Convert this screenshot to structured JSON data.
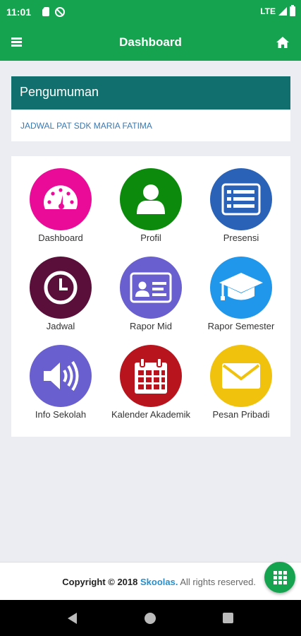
{
  "status_bar": {
    "time": "11:01",
    "network": "LTE"
  },
  "header": {
    "title": "Dashboard",
    "menu_icon": "menu-icon",
    "home_icon": "home-icon"
  },
  "announcement": {
    "title": "Pengumuman",
    "items": [
      "JADWAL PAT SDK MARIA FATIMA"
    ]
  },
  "menu": {
    "items": [
      {
        "label": "Dashboard",
        "icon": "gauge-icon",
        "color": "#ea0c99"
      },
      {
        "label": "Profil",
        "icon": "user-icon",
        "color": "#0c8a0c"
      },
      {
        "label": "Presensi",
        "icon": "list-icon",
        "color": "#2a62b8"
      },
      {
        "label": "Jadwal",
        "icon": "clock-icon",
        "color": "#5a0f3a"
      },
      {
        "label": "Rapor Mid",
        "icon": "id-card-icon",
        "color": "#6a5fcf"
      },
      {
        "label": "Rapor Semester",
        "icon": "graduation-cap-icon",
        "color": "#2197ec"
      },
      {
        "label": "Info Sekolah",
        "icon": "speaker-icon",
        "color": "#6a5fcf"
      },
      {
        "label": "Kalender Akademik",
        "icon": "calendar-icon",
        "color": "#b7141e"
      },
      {
        "label": "Pesan Pribadi",
        "icon": "envelope-icon",
        "color": "#f0c20d"
      }
    ]
  },
  "footer": {
    "copyright_prefix": "Copyright © 2018 ",
    "brand": "Skoolas.",
    "suffix": " All rights reserved."
  },
  "fab_icon": "grid-icon",
  "colors": {
    "primary": "#15a34f",
    "announcement_header": "#11706d",
    "link": "#3a78b0"
  }
}
